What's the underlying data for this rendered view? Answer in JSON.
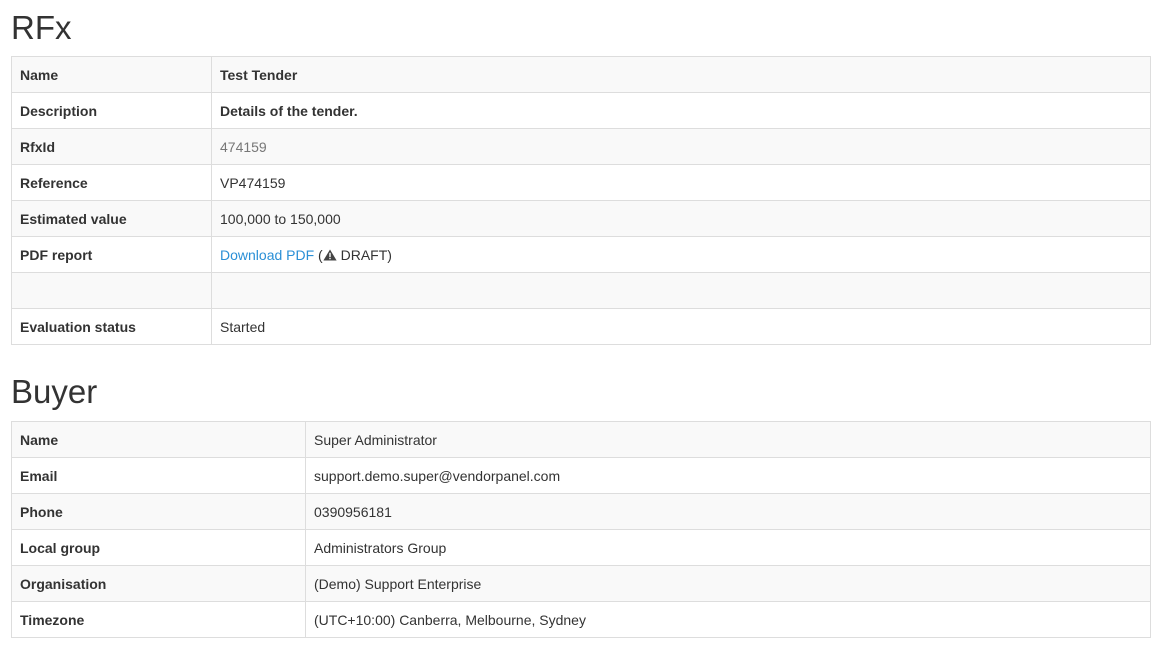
{
  "rfx": {
    "title": "RFx",
    "rows": {
      "name": {
        "label": "Name",
        "value": "Test Tender"
      },
      "description": {
        "label": "Description",
        "value": "Details of the tender."
      },
      "rfxid": {
        "label": "RfxId",
        "value": "474159"
      },
      "reference": {
        "label": "Reference",
        "value": "VP474159"
      },
      "estimated_value": {
        "label": "Estimated value",
        "value": "100,000 to 150,000"
      },
      "pdf_report": {
        "label": "PDF report",
        "link_text": "Download PDF",
        "open_paren": "(",
        "warning_icon": "warning-triangle-icon",
        "status_text": "DRAFT)"
      },
      "evaluation_status": {
        "label": "Evaluation status",
        "value": "Started"
      }
    }
  },
  "buyer": {
    "title": "Buyer",
    "rows": {
      "name": {
        "label": "Name",
        "value": "Super Administrator"
      },
      "email": {
        "label": "Email",
        "value": "support.demo.super@vendorpanel.com"
      },
      "phone": {
        "label": "Phone",
        "value": "0390956181"
      },
      "local_group": {
        "label": "Local group",
        "value": "Administrators Group"
      },
      "organisation": {
        "label": "Organisation",
        "value": "(Demo) Support Enterprise"
      },
      "timezone": {
        "label": "Timezone",
        "value": "(UTC+10:00) Canberra, Melbourne, Sydney"
      }
    }
  },
  "colors": {
    "link": "#2a8fd6",
    "border": "#dddddd",
    "stripe": "#f9f9f9",
    "muted": "#777777"
  }
}
